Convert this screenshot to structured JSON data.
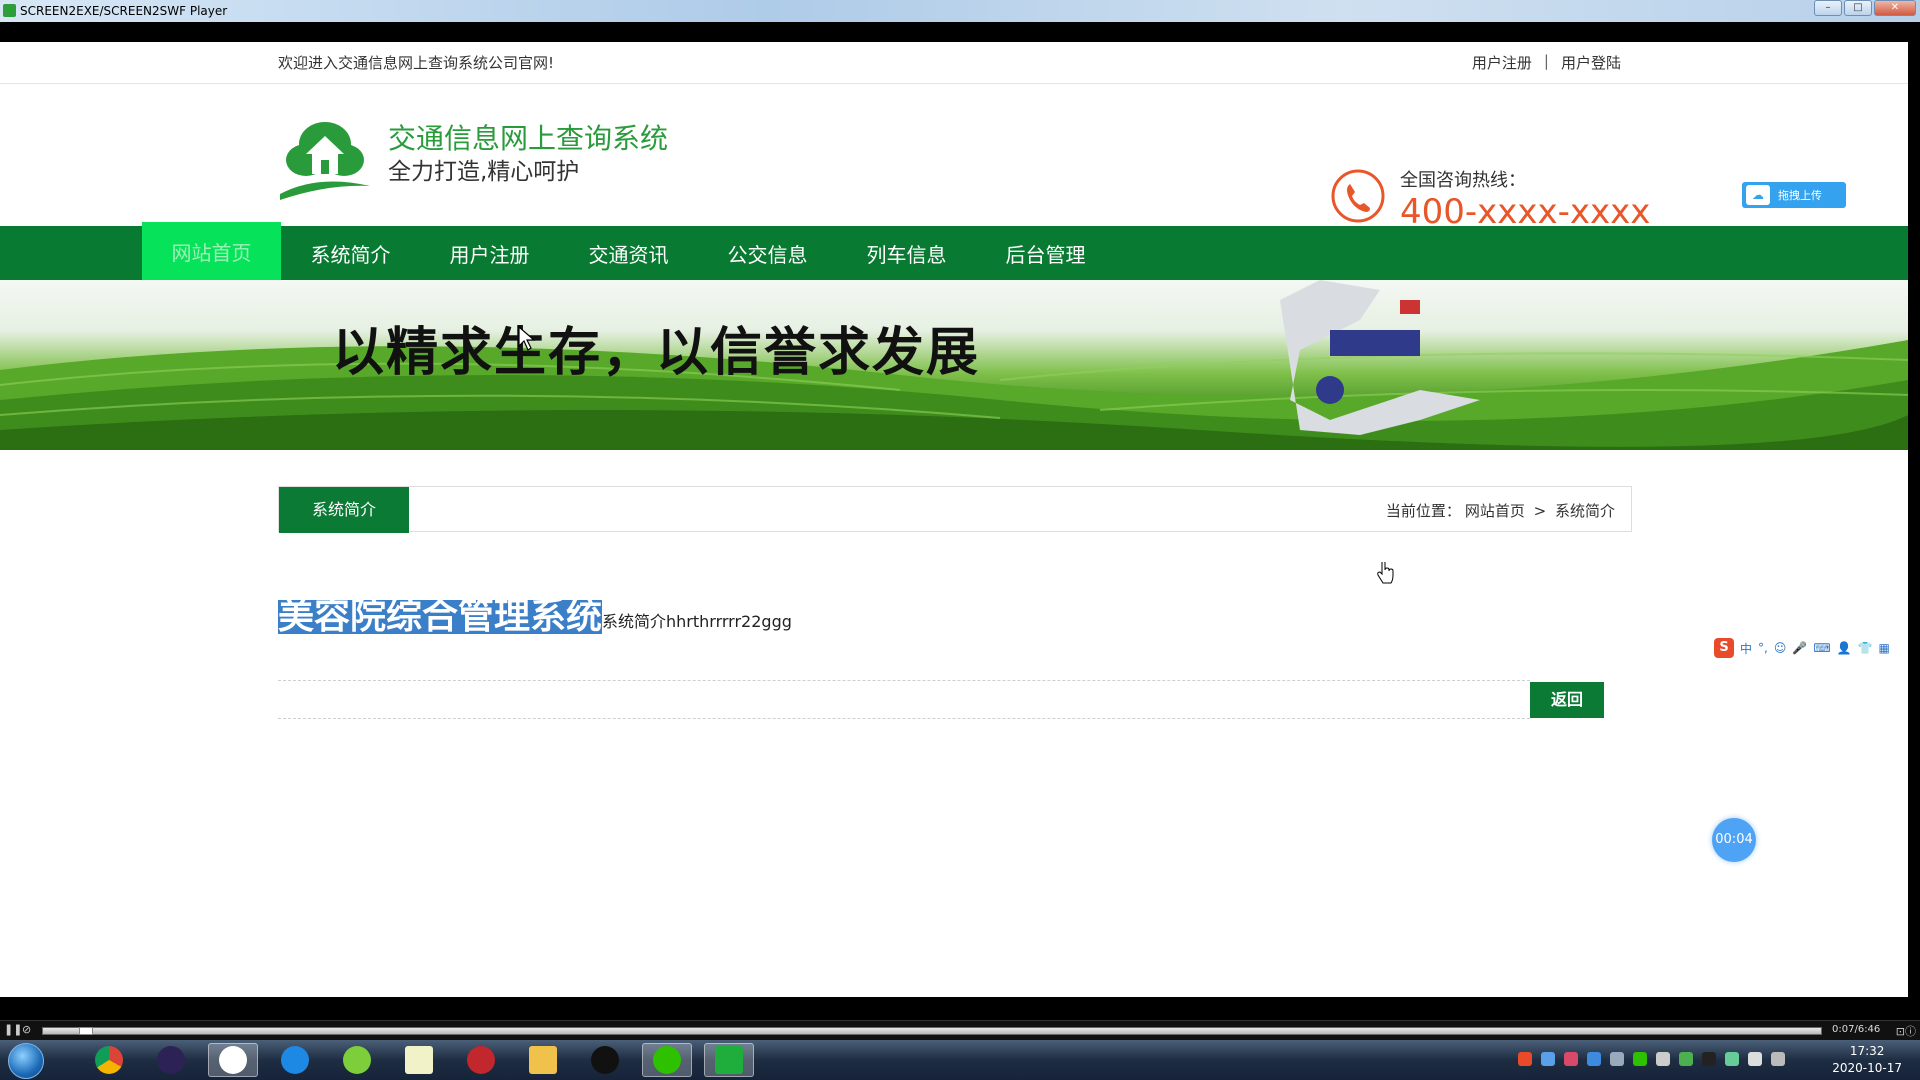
{
  "window": {
    "title": "SCREEN2EXE/SCREEN2SWF Player",
    "controls": [
      "–",
      "□",
      "✕"
    ]
  },
  "topbar": {
    "welcome": "欢迎进入交通信息网上查询系统公司官网!",
    "register": "用户注册",
    "separator": "|",
    "login": "用户登陆"
  },
  "header": {
    "site_title": "交通信息网上查询系统",
    "slogan": "全力打造,精心呵护",
    "hotline_label": "全国咨询热线：",
    "hotline_number": "400-xxxx-xxxx",
    "upload_label": "拖拽上传"
  },
  "nav": {
    "items": [
      {
        "label": "网站首页",
        "active": true
      },
      {
        "label": "系统简介",
        "active": false
      },
      {
        "label": "用户注册",
        "active": false
      },
      {
        "label": "交通资讯",
        "active": false
      },
      {
        "label": "公交信息",
        "active": false
      },
      {
        "label": "列车信息",
        "active": false
      },
      {
        "label": "后台管理",
        "active": false
      }
    ]
  },
  "banner": {
    "slogan": "以精求生存，以信誉求发展"
  },
  "section": {
    "tab": "系统简介",
    "breadcrumb_prefix": "当前位置：",
    "breadcrumb_home": "网站首页",
    "breadcrumb_arrow": ">",
    "breadcrumb_current": "系统简介"
  },
  "article": {
    "title": "美容院综合管理系统",
    "body": "系统简介hhrthrrrrr22ggg",
    "back_button": "返回"
  },
  "ime": {
    "logo": "S",
    "mode": "中",
    "icons": [
      "°,",
      "☺",
      "🎤",
      "⌨",
      "👤",
      "👕",
      "▦"
    ]
  },
  "timer": "00:04",
  "player": {
    "time": "0:07/6:46"
  },
  "taskbar": {
    "clock_time": "17:32",
    "clock_date": "2020-10-17"
  },
  "colors": {
    "nav_green": "#087a32",
    "active_green": "#06e35a",
    "title_green": "#2a9b3b",
    "hotline_orange": "#e8562a"
  }
}
